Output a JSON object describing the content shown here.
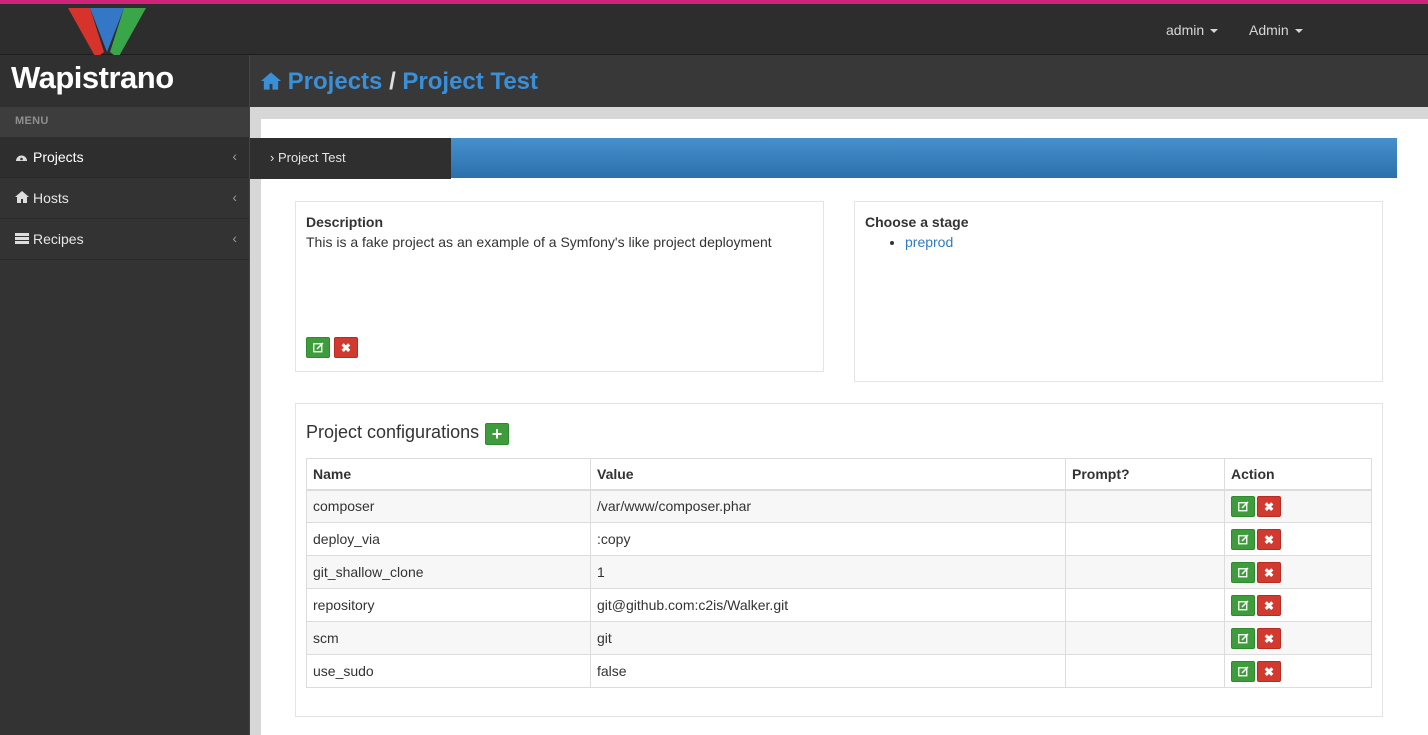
{
  "app": {
    "name": "Wapistrano",
    "accent": "#3a8fd6",
    "top_border_color": "#d0237a"
  },
  "topbar": {
    "user_menu": "admin",
    "admin_menu": "Admin"
  },
  "sidebar": {
    "menu_title": "MENU",
    "items": [
      {
        "label": "Projects",
        "icon": "dashboard-icon"
      },
      {
        "label": "Hosts",
        "icon": "home-icon"
      },
      {
        "label": "Recipes",
        "icon": "list-icon"
      }
    ]
  },
  "header": {
    "crumb_root": "Projects",
    "separator": "/",
    "crumb_current": "Project Test"
  },
  "breadcrumb": {
    "label": "› Project Test"
  },
  "description": {
    "title": "Description",
    "text": "This is a fake project as an example of a Symfony's like project deployment"
  },
  "stage": {
    "title": "Choose a stage",
    "items": [
      "preprod"
    ]
  },
  "config": {
    "title": "Project configurations",
    "columns": [
      "Name",
      "Value",
      "Prompt?",
      "Action"
    ],
    "rows": [
      {
        "name": "composer",
        "value": "/var/www/composer.phar",
        "prompt": ""
      },
      {
        "name": "deploy_via",
        "value": ":copy",
        "prompt": ""
      },
      {
        "name": "git_shallow_clone",
        "value": "1",
        "prompt": ""
      },
      {
        "name": "repository",
        "value": "git@github.com:c2is/Walker.git",
        "prompt": ""
      },
      {
        "name": "scm",
        "value": "git",
        "prompt": ""
      },
      {
        "name": "use_sudo",
        "value": "false",
        "prompt": ""
      }
    ]
  }
}
